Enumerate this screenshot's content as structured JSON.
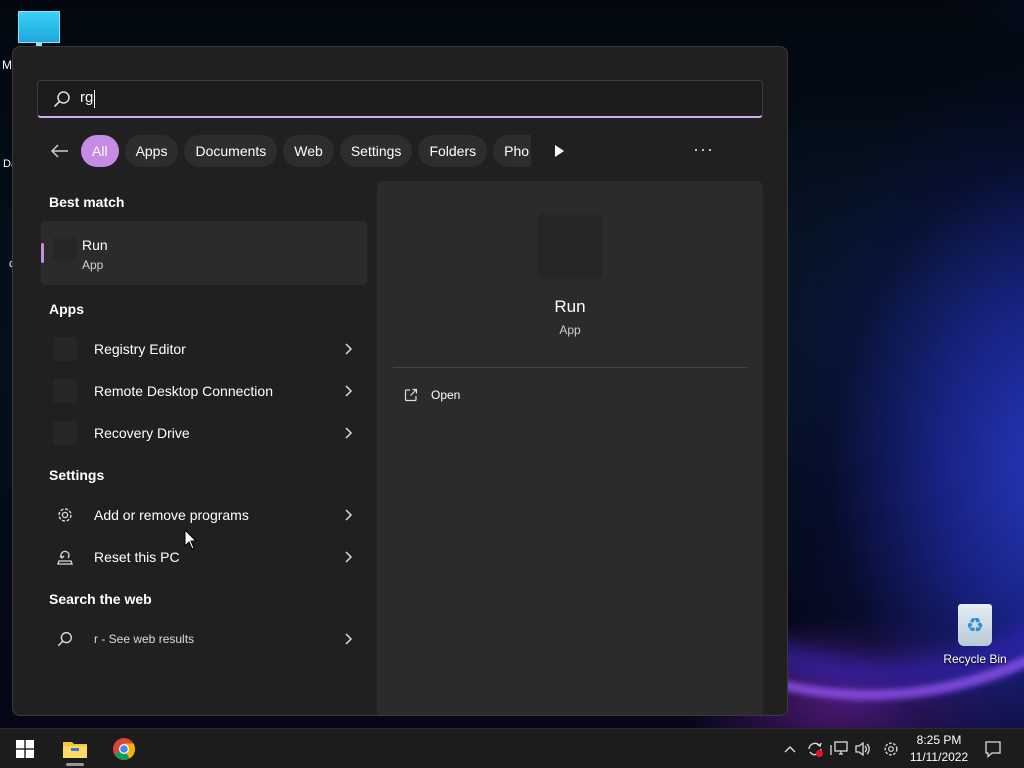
{
  "desktop": {
    "recycle_bin_label": "Recycle Bin",
    "edge_letters": [
      "M",
      "Da",
      "c"
    ]
  },
  "search": {
    "query": "rg"
  },
  "filters": {
    "chips": [
      "All",
      "Apps",
      "Documents",
      "Web",
      "Settings",
      "Folders",
      "Pho"
    ],
    "active": "All"
  },
  "best_match": {
    "title": "Best match",
    "name": "Run",
    "type": "App"
  },
  "apps": {
    "title": "Apps",
    "items": [
      "Registry Editor",
      "Remote Desktop Connection",
      "Recovery Drive"
    ]
  },
  "settings": {
    "title": "Settings",
    "items": [
      "Add or remove programs",
      "Reset this PC"
    ]
  },
  "web": {
    "title": "Search the web",
    "item": "r - See web results"
  },
  "preview": {
    "name": "Run",
    "type": "App",
    "open_label": "Open"
  },
  "taskbar": {
    "time": "8:25 PM",
    "date": "11/11/2022"
  },
  "colors": {
    "accent": "#c68be4",
    "panel_bg": "#202020",
    "preview_bg": "#2b2b2b",
    "taskbar_bg": "#1c1c1c"
  }
}
